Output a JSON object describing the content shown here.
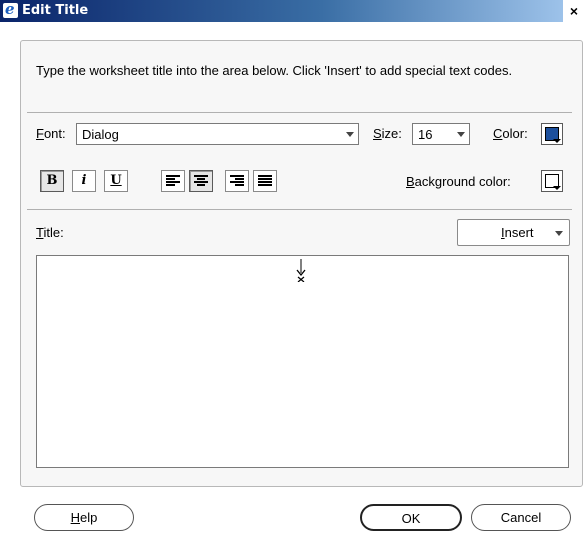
{
  "window": {
    "title": "Edit Title",
    "close_label": "×"
  },
  "instructions": "Type the worksheet title into the area below. Click 'Insert' to add special text codes.",
  "font": {
    "label_mnemonic": "F",
    "label_rest": "ont:",
    "value": "Dialog"
  },
  "size": {
    "label_mnemonic": "S",
    "label_rest": "ize:",
    "value": "16"
  },
  "color": {
    "label_mnemonic": "C",
    "label_rest": "olor:",
    "swatch": "#1c4f9c"
  },
  "style_buttons": {
    "bold": "B",
    "italic": "i",
    "underline": "U"
  },
  "background_color": {
    "label_mnemonic": "B",
    "label_rest": "ackground color:",
    "swatch": "#ffffff"
  },
  "title_field": {
    "label_mnemonic": "T",
    "label_rest": "itle:",
    "value": ""
  },
  "insert": {
    "label_mnemonic": "I",
    "label_rest": "nsert"
  },
  "buttons": {
    "help": {
      "mnemonic": "H",
      "rest": "elp"
    },
    "ok": "OK",
    "cancel": "Cancel"
  }
}
